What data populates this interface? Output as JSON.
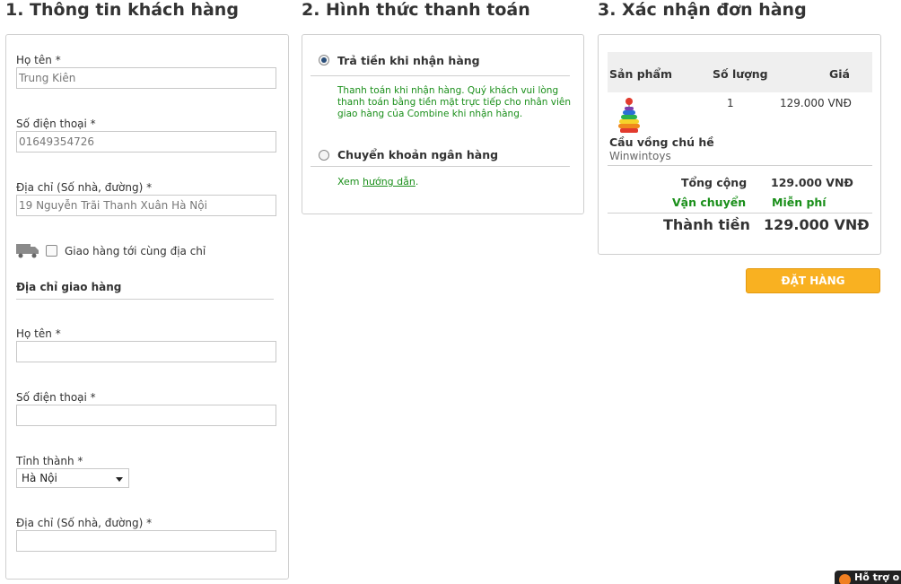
{
  "sections": {
    "customer": "1. Thông tin khách hàng",
    "payment": "2. Hình thức thanh toán",
    "confirm": "3. Xác nhận đơn hàng"
  },
  "customer": {
    "name_label": "Họ tên *",
    "name_value": "Trung Kiên",
    "phone_label": "Số điện thoại *",
    "phone_value": "01649354726",
    "address_label": "Địa chỉ (Số nhà, đường) *",
    "address_value": "19 Nguyễn Trãi Thanh Xuân Hà Nội",
    "same_address_label": "Giao hàng tới cùng địa chỉ",
    "same_address_checked": false
  },
  "shipping": {
    "title": "Địa chỉ giao hàng",
    "name_label": "Họ tên *",
    "name_value": "",
    "phone_label": "Số điện thoại *",
    "phone_value": "",
    "city_label": "Tỉnh thành *",
    "city_value": "Hà Nội",
    "address_label": "Địa chỉ (Số nhà, đường) *",
    "address_value": ""
  },
  "payment": {
    "cod_label": "Trả tiền khi nhận hàng",
    "cod_selected": true,
    "cod_desc": "Thanh toán khi nhận hàng. Quý khách vui lòng thanh toán bằng tiền mặt trực tiếp cho nhân viên giao hàng của Combine khi nhận hàng.",
    "bank_label": "Chuyển khoản ngân hàng",
    "bank_selected": false,
    "guide_prefix": "Xem",
    "guide_link": "hướng dẫn",
    "guide_suffix": "."
  },
  "order": {
    "col_product": "Sản phẩm",
    "col_qty": "Số lượng",
    "col_price": "Giá",
    "item": {
      "qty": "1",
      "price": "129.000 VNĐ",
      "name": "Cầu vồng chú hề",
      "brand": "Winwintoys"
    },
    "total_label": "Tổng cộng",
    "total_value": "129.000 VNĐ",
    "shipping_label": "Vận chuyển",
    "shipping_value": "Miễn phí",
    "grand_label": "Thành tiền",
    "grand_value": "129.000  VNĐ"
  },
  "order_button": "ĐẶT HÀNG",
  "support_label": "Hỗ trợ o",
  "colors": {
    "accent_green": "#1a8f1a",
    "button_orange": "#f9b121",
    "support_orange": "#f07f21"
  }
}
